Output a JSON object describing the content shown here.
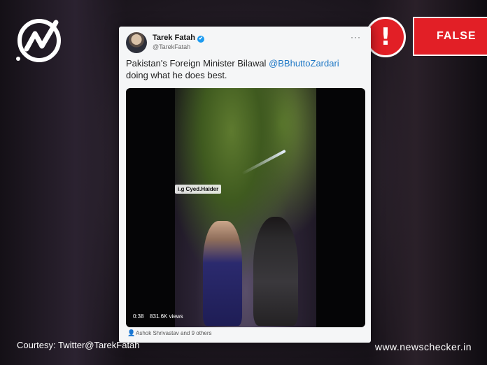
{
  "colors": {
    "accent_red": "#e21f26",
    "link_blue": "#1d77c5",
    "verified_blue": "#1d9bf0"
  },
  "brand": {
    "logo_icon": "newschecker-logo-icon"
  },
  "verdict": {
    "alert_icon": "exclamation-icon",
    "alert_symbol": "!",
    "label": "FALSE"
  },
  "tweet": {
    "author_name": "Tarek Fatah",
    "verified_symbol": "✔",
    "handle": "@TarekFatah",
    "more_symbol": "···",
    "text_before": "Pakistan's Foreign Minister Bilawal ",
    "mention": "@BBhuttoZardari",
    "text_after": " doing what he does best.",
    "video": {
      "watermark": "i.g Cyed.Haider",
      "time": "0:38",
      "views": "831.6K views"
    },
    "likers_icon": "person-icon",
    "likers_symbol": "👤",
    "likers": "Ashok Shrivastav and 9 others"
  },
  "footer": {
    "courtesy": "Courtesy: Twitter@TarekFatah",
    "site": "www.newschecker.in"
  }
}
